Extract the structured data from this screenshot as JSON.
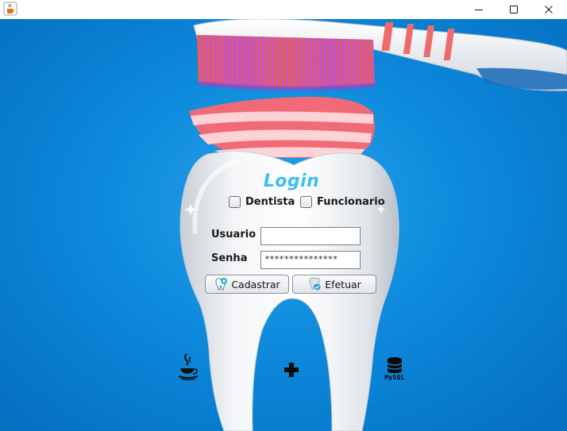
{
  "window": {
    "title": "",
    "controls": {
      "minimize_icon": "minimize-icon",
      "maximize_icon": "maximize-icon",
      "close_icon": "close-icon"
    }
  },
  "login": {
    "title": "Login",
    "role_options": [
      {
        "label": "Dentista",
        "checked": false
      },
      {
        "label": "Funcionario",
        "checked": false
      }
    ],
    "usuario_label": "Usuario",
    "usuario_value": "",
    "senha_label": "Senha",
    "senha_value": "***************",
    "cadastrar_label": "Cadastrar",
    "efetuar_label": "Efetuar"
  },
  "footer": {
    "java_icon": "java-coffee-cup-icon",
    "plus_icon": "plus-icon",
    "mysql_icon": "mysql-database-icon",
    "mysql_label": "MySQL"
  },
  "colors": {
    "background": "#0a86da",
    "login_title": "#3cc0f0",
    "toothpaste": "#f0566a",
    "bristles": "#b048d8"
  }
}
